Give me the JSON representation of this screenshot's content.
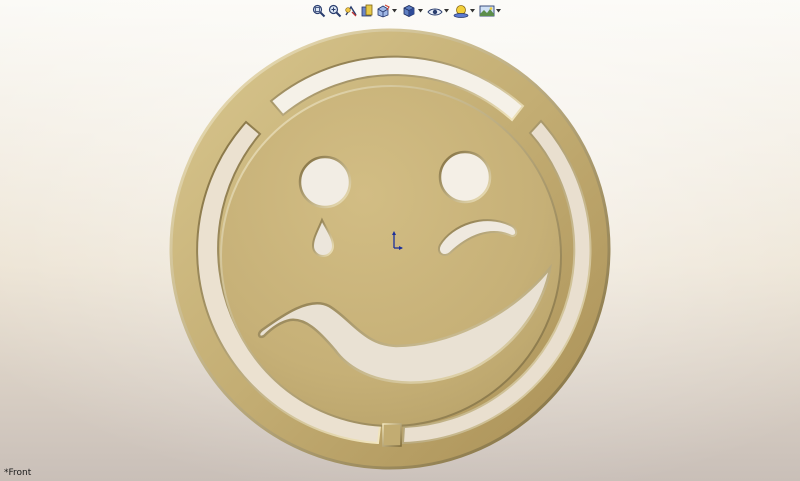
{
  "viewport": {
    "view_name": "*Front",
    "background_top": "#fbfaf6",
    "background_mid": "#ece3d3",
    "background_bottom": "#c9bfb8"
  },
  "part": {
    "description_icon": "sad-smiley-part",
    "base_color": "#c9b47a",
    "highlight_color": "#e6d6a4",
    "shadow_color": "#8f7a45"
  },
  "toolbar": {
    "items": [
      {
        "name": "zoom-to-fit",
        "icon": "zoom-fit-icon",
        "dropdown": false
      },
      {
        "name": "zoom-to-area",
        "icon": "zoom-area-icon",
        "dropdown": false
      },
      {
        "name": "previous-view",
        "icon": "previous-view-icon",
        "dropdown": false
      },
      {
        "name": "section-view",
        "icon": "section-view-icon",
        "dropdown": false
      },
      {
        "name": "view-orientation",
        "icon": "view-orientation-icon",
        "dropdown": true
      },
      {
        "name": "display-style",
        "icon": "display-style-icon",
        "dropdown": true
      },
      {
        "name": "hide-show-items",
        "icon": "hide-show-icon",
        "dropdown": true
      },
      {
        "name": "edit-appearance",
        "icon": "appearance-icon",
        "dropdown": true
      },
      {
        "name": "apply-scene",
        "icon": "scene-icon",
        "dropdown": true
      }
    ]
  }
}
